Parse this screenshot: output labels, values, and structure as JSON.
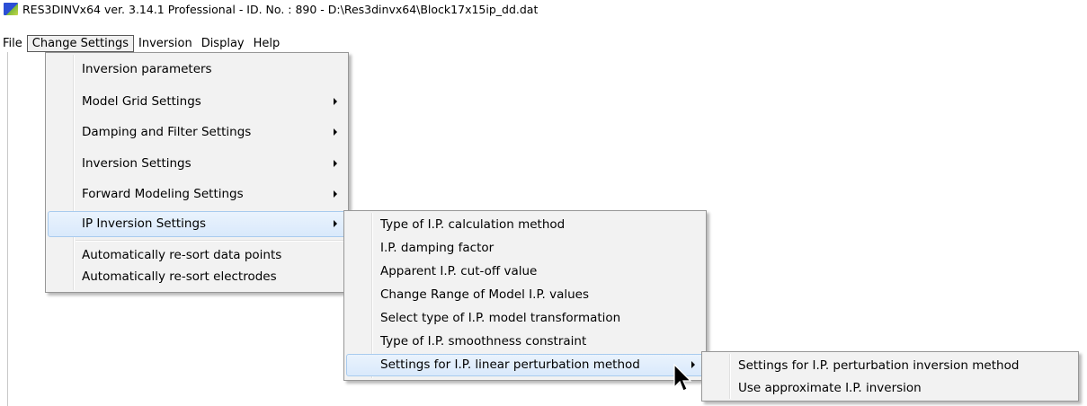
{
  "window": {
    "title": "RES3DINVx64 ver. 3.14.1 Professional - ID. No. : 890  - D:\\Res3dinvx64\\Block17x15ip_dd.dat"
  },
  "menubar": {
    "items": [
      "File",
      "Change Settings",
      "Inversion",
      "Display",
      "Help"
    ]
  },
  "change_settings_menu": {
    "items": [
      {
        "label": "Inversion parameters"
      },
      {
        "label": "Model Grid Settings"
      },
      {
        "label": "Damping and Filter Settings"
      },
      {
        "label": "Inversion Settings"
      },
      {
        "label": "Forward Modeling Settings"
      },
      {
        "label": "IP Inversion Settings"
      },
      {
        "label": "Automatically re-sort data points"
      },
      {
        "label": "Automatically re-sort electrodes"
      }
    ]
  },
  "ip_inversion_submenu": {
    "items": [
      {
        "label": "Type of I.P. calculation method"
      },
      {
        "label": "I.P. damping factor"
      },
      {
        "label": "Apparent I.P. cut-off value"
      },
      {
        "label": "Change Range of Model I.P. values"
      },
      {
        "label": "Select type of I.P. model transformation"
      },
      {
        "label": "Type of I.P. smoothness constraint"
      },
      {
        "label": "Settings for I.P. linear perturbation method"
      }
    ]
  },
  "linear_perturbation_submenu": {
    "items": [
      {
        "label": "Settings for I.P. perturbation inversion method"
      },
      {
        "label": "Use approximate I.P. inversion"
      }
    ]
  },
  "colors": {
    "highlight": "#d9e9fb",
    "menu_bg": "#f2f2f2"
  }
}
